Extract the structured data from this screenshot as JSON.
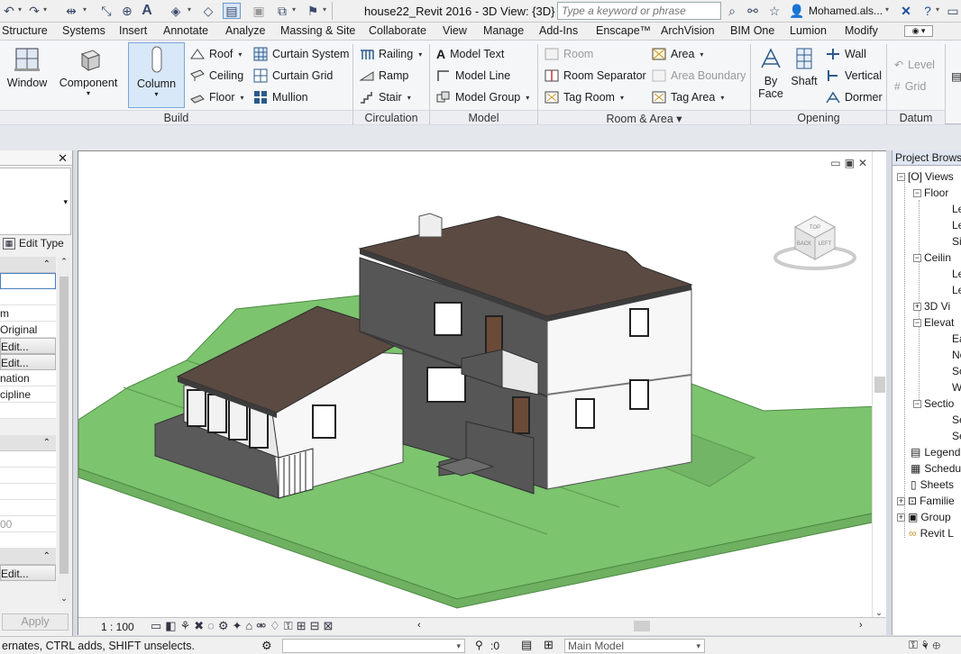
{
  "window": {
    "title": "house22_Revit 2016 - 3D View: {3D}",
    "user": "Mohamed.als..."
  },
  "search": {
    "placeholder": "Type a keyword or phrase"
  },
  "tabs": [
    "Structure",
    "Systems",
    "Insert",
    "Annotate",
    "Analyze",
    "Massing & Site",
    "Collaborate",
    "View",
    "Manage",
    "Add-Ins",
    "Enscape™",
    "ArchVision",
    "BIM One",
    "Lumion",
    "Modify"
  ],
  "ribbon": {
    "build": {
      "label": "Build",
      "window": "Window",
      "component": "Component",
      "column": "Column",
      "roof": "Roof",
      "ceiling": "Ceiling",
      "floor": "Floor",
      "curtain_system": "Curtain System",
      "curtain_grid": "Curtain Grid",
      "mullion": "Mullion"
    },
    "circulation": {
      "label": "Circulation",
      "railing": "Railing",
      "ramp": "Ramp",
      "stair": "Stair"
    },
    "model": {
      "label": "Model",
      "model_text": "Model Text",
      "model_line": "Model Line",
      "model_group": "Model Group"
    },
    "room_area": {
      "label": "Room & Area",
      "room": "Room",
      "room_separator": "Room Separator",
      "tag_room": "Tag Room",
      "area": "Area",
      "area_boundary": "Area Boundary",
      "tag_area": "Tag Area"
    },
    "opening": {
      "label": "Opening",
      "by_face_1": "By",
      "by_face_2": "Face",
      "shaft": "Shaft",
      "wall": "Wall",
      "vertical": "Vertical",
      "dormer": "Dormer"
    },
    "datum": {
      "label": "Datum",
      "level": "Level",
      "grid": "Grid"
    }
  },
  "properties": {
    "edit_type": "Edit Type",
    "rows": [
      "m",
      "Original",
      "Edit...",
      "Edit...",
      "nation",
      "cipline"
    ],
    "value_00": "00",
    "edit_last": "Edit...",
    "apply": "Apply"
  },
  "view": {
    "scale": "1 : 100",
    "cube_top": "TOP",
    "cube_back": "BACK",
    "cube_left": "LEFT"
  },
  "project_browser": {
    "title": "Project Browser",
    "nodes": [
      "Views",
      "Floor",
      "Le",
      "Le",
      "Si",
      "Ceilin",
      "Le",
      "Le",
      "3D Vi",
      "Elevat",
      "Ea",
      "No",
      "So",
      "W",
      "Sectio",
      "Se",
      "Se",
      "Legend",
      "Schedu",
      "Sheets",
      "Familie",
      "Group",
      "Revit L"
    ]
  },
  "status": {
    "text": "ernates, CTRL adds, SHIFT unselects.",
    "count": ":0",
    "model": "Main Model"
  },
  "colors": {
    "ground": "#7cc46e",
    "roof": "#5b4a42",
    "dark_wall": "#565656",
    "white_wall": "#f7f7f7",
    "accent": "#3b76b8"
  }
}
